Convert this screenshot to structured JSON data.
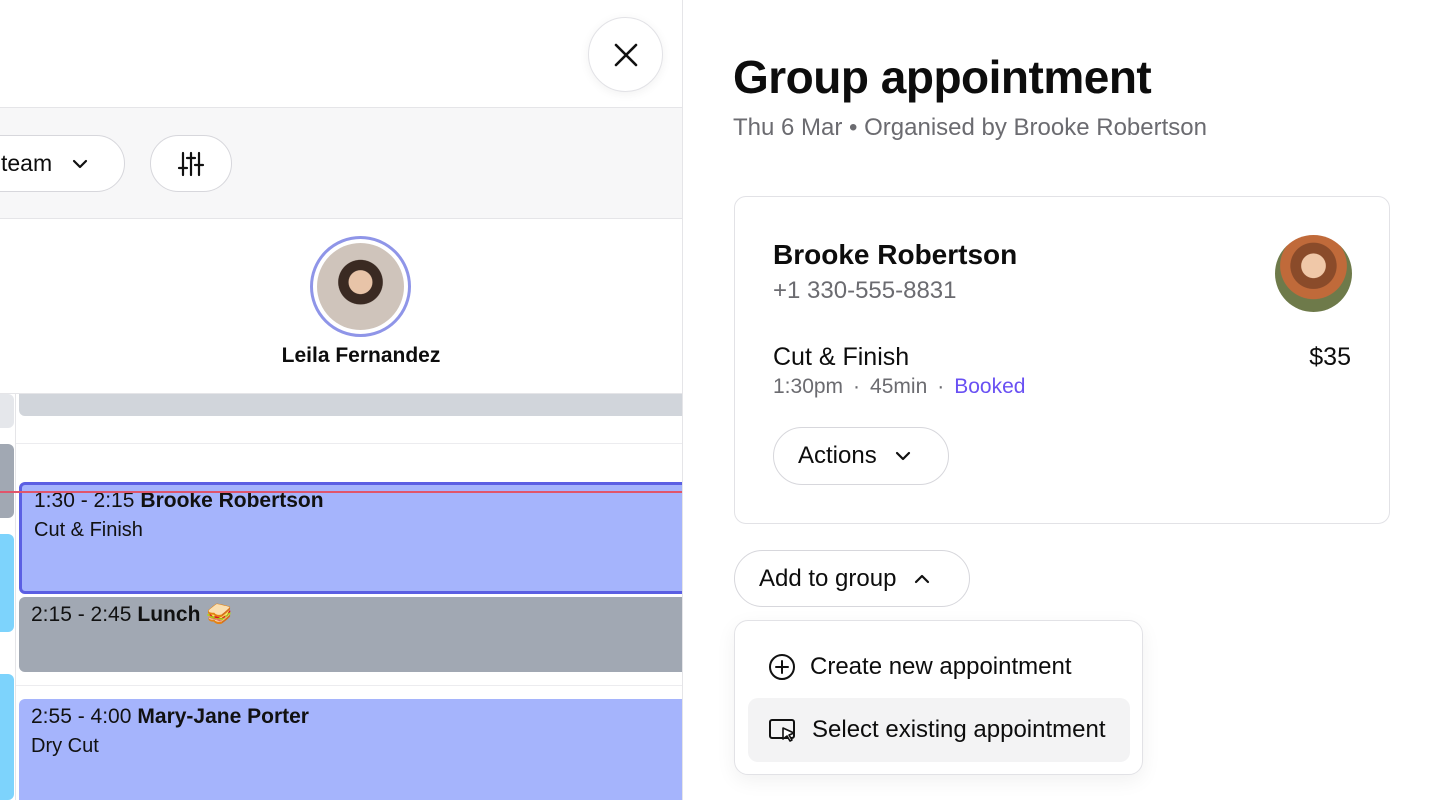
{
  "calendar": {
    "team_label": "team",
    "staff": {
      "name": "Leila Fernandez"
    },
    "appointments": [
      {
        "time": "1:30 - 2:15",
        "client": "Brooke Robertson",
        "service": "Cut & Finish"
      },
      {
        "time": "2:15 - 2:45",
        "client": "Lunch 🥪"
      },
      {
        "time": "2:55 - 4:00",
        "client": "Mary-Jane Porter",
        "service": "Dry Cut"
      }
    ]
  },
  "panel": {
    "title": "Group appointment",
    "subtitle": "Thu 6 Mar • Organised by Brooke Robertson",
    "client": {
      "name": "Brooke Robertson",
      "phone": "+1 330-555-8831"
    },
    "service": {
      "name": "Cut & Finish",
      "price": "$35",
      "time": "1:30pm",
      "duration": "45min",
      "status": "Booked",
      "sep": "·"
    },
    "actions_label": "Actions",
    "add_to_group_label": "Add to group",
    "dropdown": {
      "create_label": "Create new appointment",
      "select_label": "Select existing appointment"
    }
  },
  "colors": {
    "accent": "#6950f3",
    "appointment_fill": "#a5b4fc",
    "selected_border": "#5b5fe3",
    "lunch_fill": "#a1a8b3",
    "now_line": "#e0556b"
  }
}
